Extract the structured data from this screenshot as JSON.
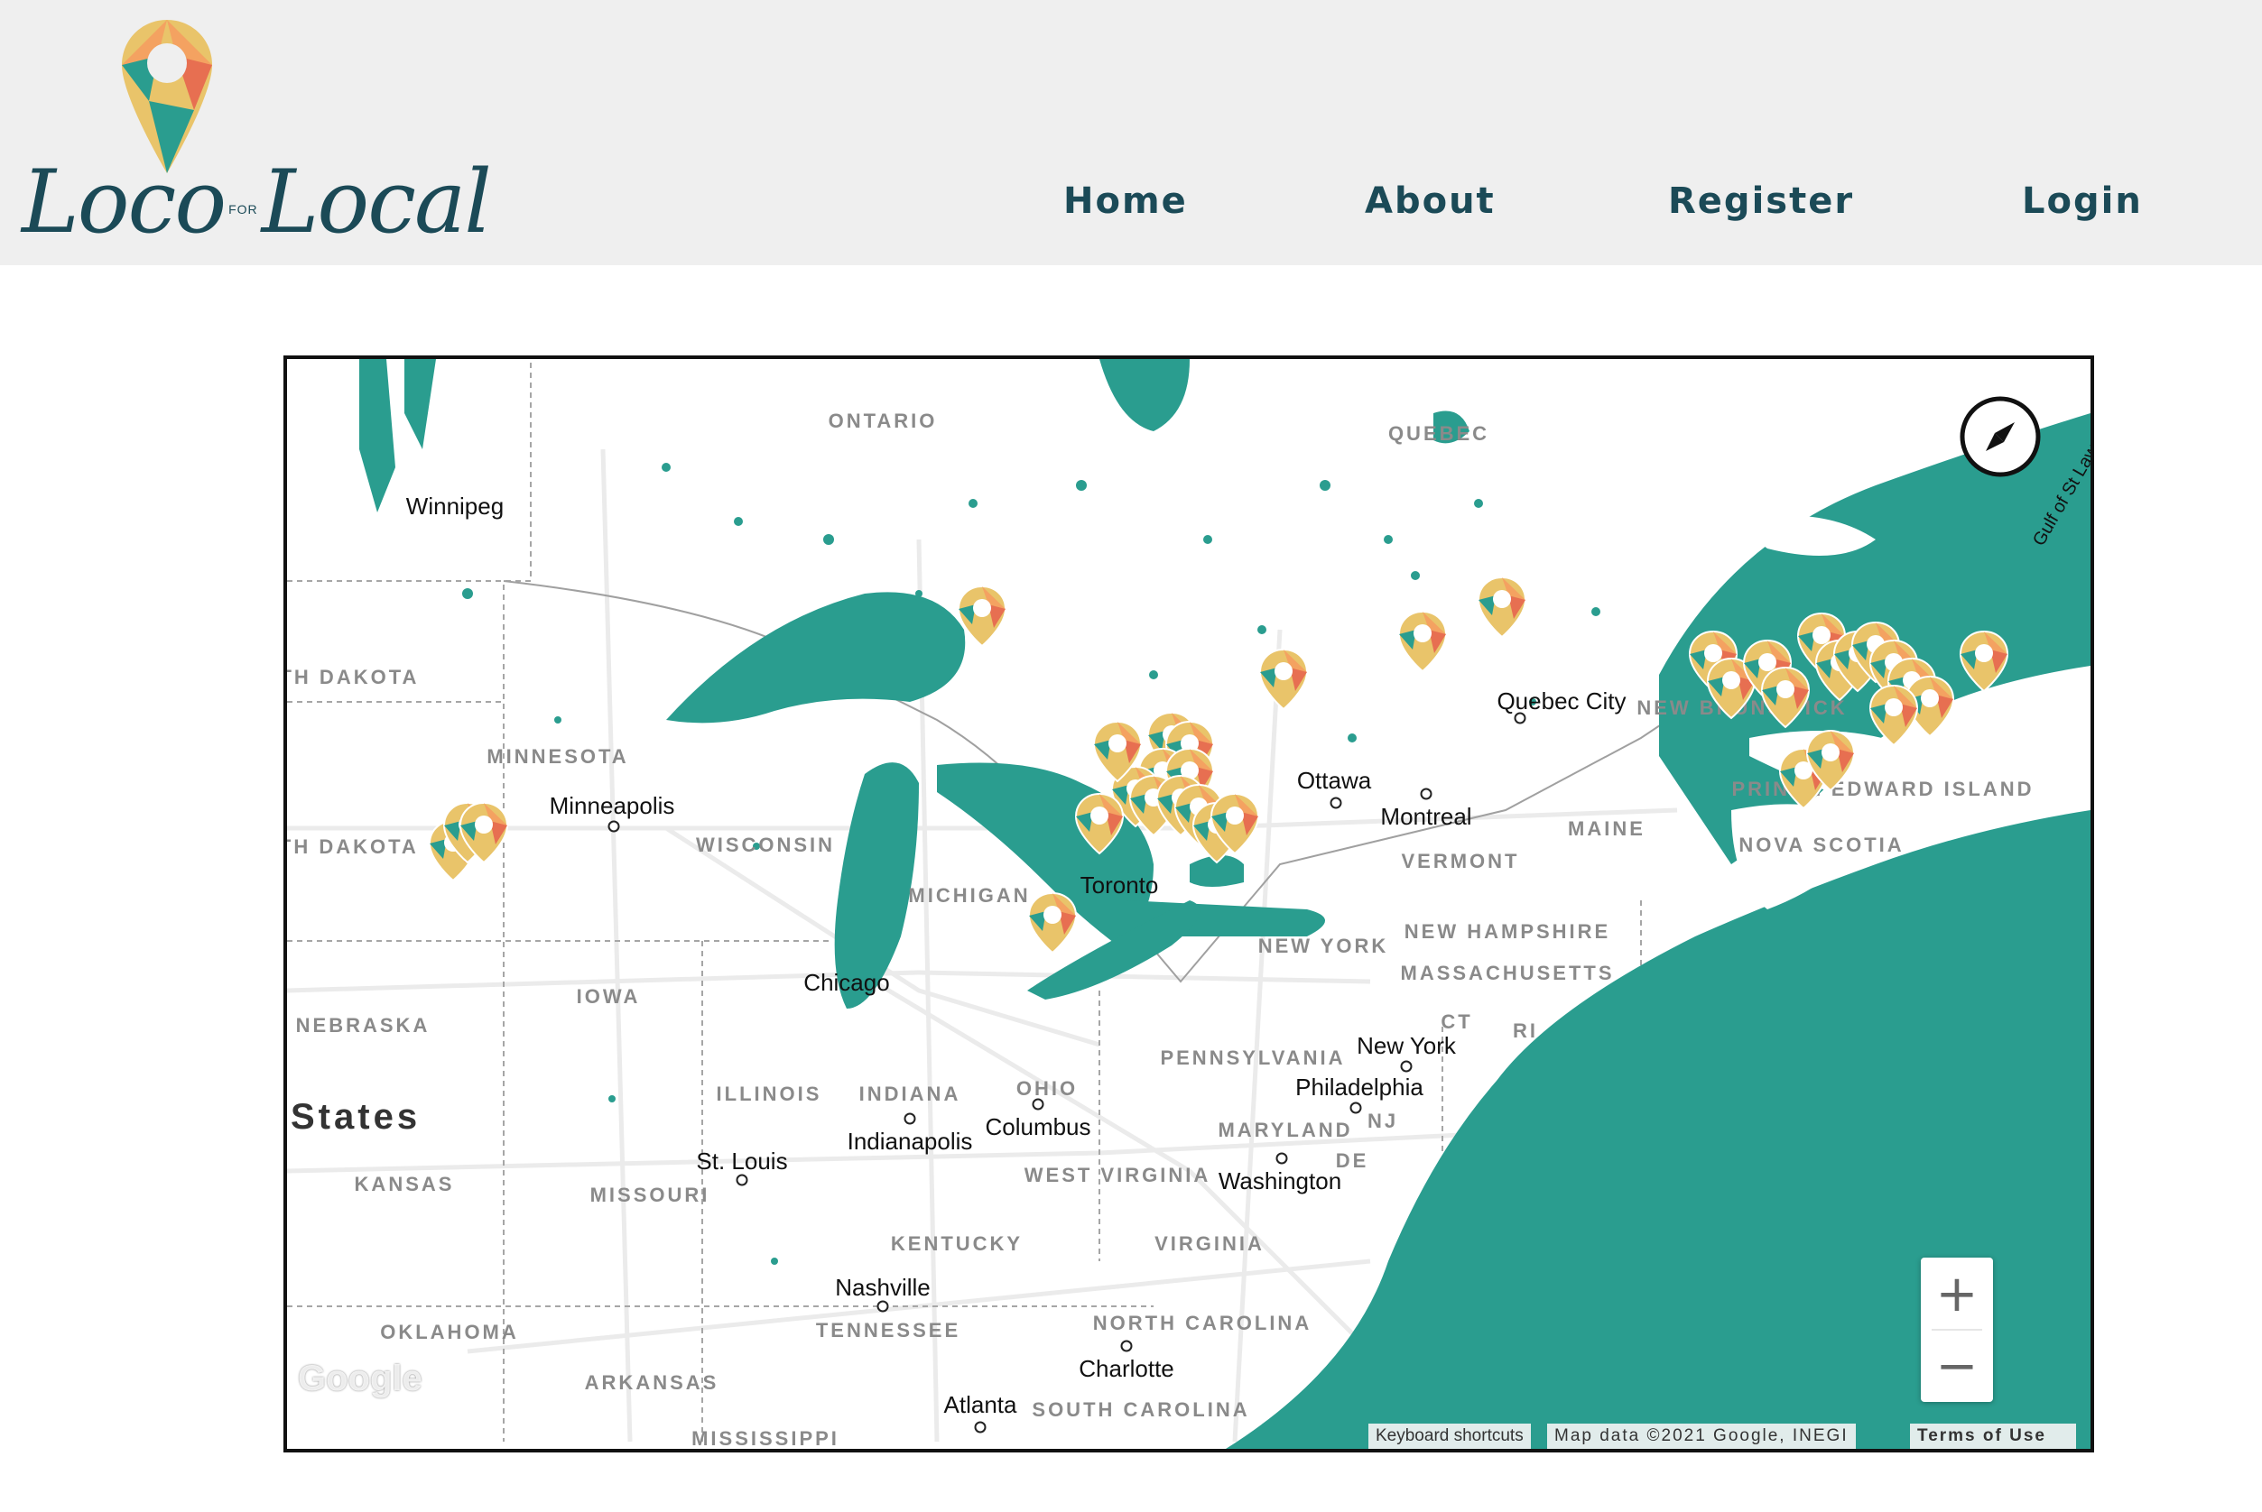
{
  "header": {
    "logo": {
      "word1": "Loco",
      "word_for": "FOR",
      "word2": "Local"
    },
    "nav": [
      {
        "label": "Home"
      },
      {
        "label": "About"
      },
      {
        "label": "Register"
      },
      {
        "label": "Login"
      }
    ]
  },
  "map": {
    "colors": {
      "water": "#2a9d8f",
      "land": "#ffffff",
      "roads": "#e9e9e9",
      "borders": "#9a9a9a",
      "marker_orange": "#f4a261",
      "marker_yellow": "#e9c46a",
      "marker_red": "#e76f51",
      "marker_teal": "#2a9d8f"
    },
    "cities": [
      "Winnipeg",
      "Minneapolis",
      "Chicago",
      "Ottawa",
      "Montreal",
      "Quebec City",
      "New York",
      "Philadelphia",
      "Washington",
      "Columbus",
      "Indianapolis",
      "St. Louis",
      "Nashville",
      "Charlotte",
      "Atlanta",
      "Toronto"
    ],
    "regions": [
      "ONTARIO",
      "QUEBEC",
      "NORTH DAKOTA",
      "MINNESOTA",
      "SOUTH DAKOTA",
      "WISCONSIN",
      "MICHIGAN",
      "IOWA",
      "NEBRASKA",
      "ILLINOIS",
      "INDIANA",
      "OHIO",
      "PENNSYLVANIA",
      "NEW YORK",
      "VERMONT",
      "MAINE",
      "NEW HAMPSHIRE",
      "MASSACHUSETTS",
      "CT",
      "RI",
      "NJ",
      "DE",
      "MARYLAND",
      "WEST VIRGINIA",
      "VIRGINIA",
      "KENTUCKY",
      "TENNESSEE",
      "NORTH CAROLINA",
      "SOUTH CAROLINA",
      "MISSISSIPPI",
      "ARKANSAS",
      "OKLAHOMA",
      "KANSAS",
      "MISSOURI",
      "NEW BRUNSWICK",
      "PRINCE EDWARD ISLAND",
      "NOVA SCOTIA"
    ],
    "country": "States",
    "water_label": "Gulf of St Lawrence",
    "zoom_in": "+",
    "zoom_out": "−",
    "google_logo": "Google",
    "attribution": {
      "shortcuts": "Keyboard shortcuts",
      "data": "Map data ©2021 Google, INEGI",
      "terms": "Terms of Use"
    },
    "compass_icon": "compass-icon",
    "marker_icon": "map-pin-icon"
  }
}
